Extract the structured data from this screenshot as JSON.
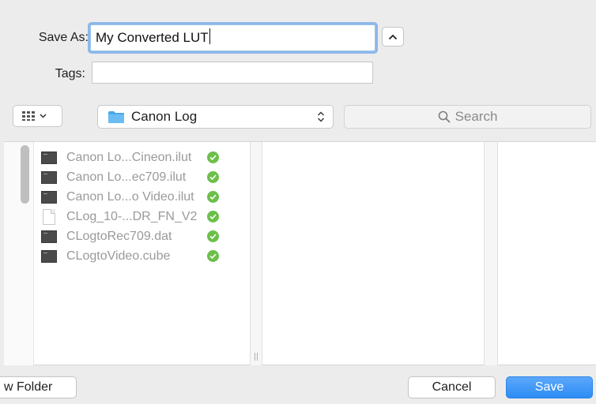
{
  "form": {
    "save_as_label": "Save As:",
    "filename_value": "My Converted LUT",
    "tags_label": "Tags:",
    "tags_value": ""
  },
  "toolbar": {
    "view_icon": "grid-view-icon",
    "location": "Canon Log",
    "search_placeholder": "Search"
  },
  "files": [
    {
      "name": "Canon Lo...Cineon.ilut",
      "icon": "document-icon",
      "status": "checkmark-icon"
    },
    {
      "name": "Canon Lo...ec709.ilut",
      "icon": "document-icon",
      "status": "checkmark-icon"
    },
    {
      "name": "Canon Lo...o Video.ilut",
      "icon": "document-icon",
      "status": "checkmark-icon"
    },
    {
      "name": "CLog_10-...DR_FN_V2",
      "icon": "blank-file-icon",
      "status": "checkmark-icon"
    },
    {
      "name": "CLogtoRec709.dat",
      "icon": "document-icon",
      "status": "checkmark-icon"
    },
    {
      "name": "CLogtoVideo.cube",
      "icon": "document-icon",
      "status": "checkmark-icon"
    }
  ],
  "buttons": {
    "new_folder": "w Folder",
    "cancel": "Cancel",
    "save": "Save"
  },
  "colors": {
    "accent": "#2d8cf5",
    "folder": "#4aa8e8",
    "sync_check": "#6cc04a"
  }
}
